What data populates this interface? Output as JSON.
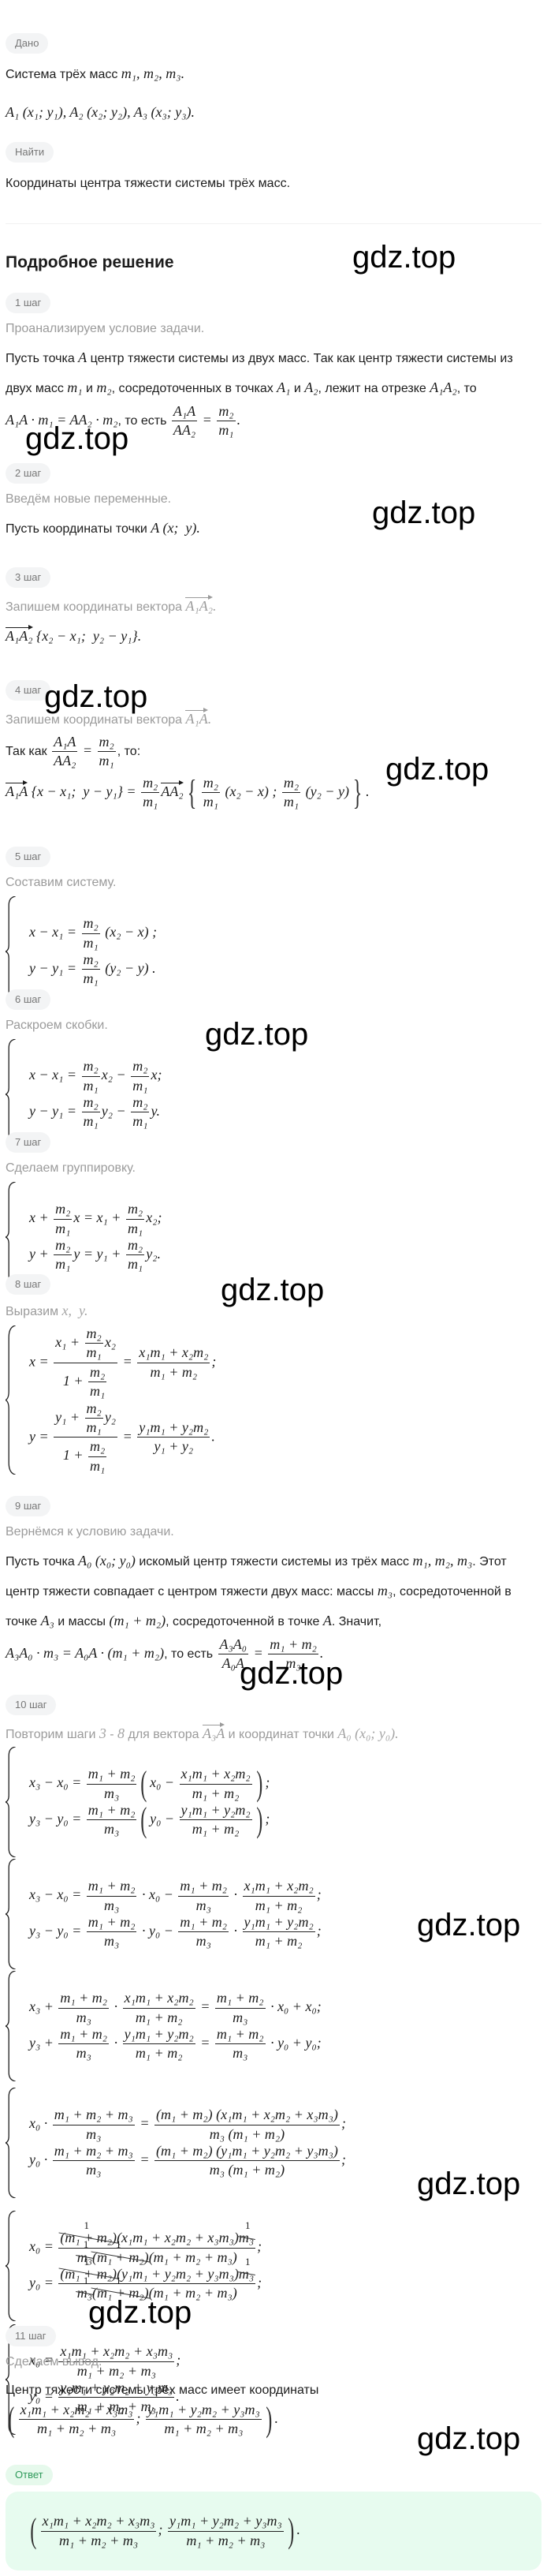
{
  "given": {
    "label": "Дано",
    "line1": [
      {
        "txt": "Система трёх масс "
      },
      "m₁, m₂, m₃."
    ],
    "line2": [
      "A₁ (x₁; y₁), A₂ (x₂; y₂), A₃ (x₃; y₃)."
    ]
  },
  "find": {
    "label": "Найти",
    "text": "Координаты центра тяжести системы трёх масс."
  },
  "solution_title": "Подробное решение",
  "steps": [
    {
      "label": "1 шаг",
      "caption": [
        {
          "txt": "Проанализируем условие задачи."
        }
      ],
      "body": [
        {
          "txt": "Пусть точка "
        },
        "A",
        {
          "txt": " центр тяжести системы из двух масс. Так как центр тяжести системы из двух масс "
        },
        "m₁",
        {
          "txt": " и "
        },
        "m₂",
        {
          "txt": ", сосредоточенных в точках "
        },
        "A₁",
        {
          "txt": " и "
        },
        "A₂",
        {
          "txt": ", лежит на отрезке "
        },
        "A₁A₂",
        {
          "txt": ", то "
        },
        "A₁A · m₁ = AA₂ · m₂",
        {
          "txt": ", то есть "
        },
        {
          "f": [
            "A₁A",
            "AA₂"
          ]
        },
        " = ",
        {
          "f": [
            "m₂",
            "m₁"
          ]
        },
        "."
      ]
    },
    {
      "label": "2 шаг",
      "caption": [
        {
          "txt": "Введём новые переменные."
        }
      ],
      "body": [
        {
          "txt": "Пусть координаты точки "
        },
        "A (x;  y)."
      ]
    },
    {
      "label": "3 шаг",
      "caption": [
        {
          "txt": "Запишем координаты вектора "
        },
        {
          "vec": "A₁A₂"
        },
        "."
      ],
      "body": [
        {
          "vec": "A₁A₂"
        },
        " {x₂ − x₁;  y₂ − y₁}."
      ]
    },
    {
      "label": "4 шаг",
      "caption": [
        {
          "txt": "Запишем координаты вектора "
        },
        {
          "vec": "A₁A"
        },
        "."
      ],
      "body": [
        {
          "txt": "Так как "
        },
        {
          "f": [
            "A₁A",
            "AA₂"
          ]
        },
        " = ",
        {
          "f": [
            "m₂",
            "m₁"
          ]
        },
        {
          "txt": ", то:"
        }
      ],
      "body2": [
        {
          "vec": "A₁A"
        },
        " {x − x₁;  y − y₁} = ",
        {
          "f": [
            "m₂",
            "m₁"
          ]
        },
        {
          "vec": "AA₂"
        },
        {
          "o": "{",
          "c": "}",
          "p": [
            {
              "f": [
                "m₂",
                "m₁"
              ]
            },
            " (x₂ − x) ; ",
            {
              "f": [
                "m₂",
                "m₁"
              ]
            },
            " (y₂ − y)"
          ]
        },
        "."
      ]
    },
    {
      "label": "5 шаг",
      "caption": [
        {
          "txt": "Составим систему."
        }
      ],
      "body": [
        {
          "sys": [
            [
              "x − x₁ = ",
              {
                "f": [
                  "m₂",
                  "m₁"
                ]
              },
              " (x₂ − x) ;"
            ],
            [
              "y − y₁ = ",
              {
                "f": [
                  "m₂",
                  "m₁"
                ]
              },
              " (y₂ − y) ."
            ]
          ]
        }
      ]
    },
    {
      "label": "6 шаг",
      "caption": [
        {
          "txt": "Раскроем скобки."
        }
      ],
      "body": [
        {
          "sys": [
            [
              "x − x₁ = ",
              {
                "f": [
                  "m₂",
                  "m₁"
                ]
              },
              "x₂ − ",
              {
                "f": [
                  "m₂",
                  "m₁"
                ]
              },
              "x;"
            ],
            [
              "y − y₁ = ",
              {
                "f": [
                  "m₂",
                  "m₁"
                ]
              },
              "y₂ − ",
              {
                "f": [
                  "m₂",
                  "m₁"
                ]
              },
              "y."
            ]
          ]
        }
      ]
    },
    {
      "label": "7 шаг",
      "caption": [
        {
          "txt": "Сделаем группировку."
        }
      ],
      "body": [
        {
          "sys": [
            [
              "x + ",
              {
                "f": [
                  "m₂",
                  "m₁"
                ]
              },
              "x = x₁ + ",
              {
                "f": [
                  "m₂",
                  "m₁"
                ]
              },
              "x₂;"
            ],
            [
              "y + ",
              {
                "f": [
                  "m₂",
                  "m₁"
                ]
              },
              "y = y₁ + ",
              {
                "f": [
                  "m₂",
                  "m₁"
                ]
              },
              "y₂."
            ]
          ]
        }
      ]
    },
    {
      "label": "8 шаг",
      "caption": [
        {
          "txt": "Выразим "
        },
        "x,  y."
      ],
      "body": [
        {
          "sys": [
            [
              "x = ",
              {
                "f": [
                  [
                    "x₁ + ",
                    {
                      "f": [
                        "m₂",
                        "m₁"
                      ]
                    },
                    "x₂"
                  ],
                  [
                    "1 + ",
                    {
                      "f": [
                        "m₂",
                        "m₁"
                      ]
                    }
                  ]
                ]
              },
              " = ",
              {
                "f": [
                  "x₁m₁ + x₂m₂",
                  "m₁ + m₂"
                ]
              },
              ";"
            ],
            [
              "y = ",
              {
                "f": [
                  [
                    "y₁ + ",
                    {
                      "f": [
                        "m₂",
                        "m₁"
                      ]
                    },
                    "y₂"
                  ],
                  [
                    "1 + ",
                    {
                      "f": [
                        "m₂",
                        "m₁"
                      ]
                    }
                  ]
                ]
              },
              " = ",
              {
                "f": [
                  "y₁m₁ + y₂m₂",
                  "y₁ + y₂"
                ]
              },
              "."
            ]
          ]
        }
      ]
    },
    {
      "label": "9 шаг",
      "caption": [
        {
          "txt": "Вернёмся к условию задачи."
        }
      ],
      "body": [
        {
          "txt": "Пусть точка "
        },
        "A₀ (x₀; y₀)",
        {
          "txt": " искомый центр тяжести системы из трёх масс "
        },
        "m₁, m₂, m₃",
        {
          "txt": ". Этот центр тяжести совпадает с центром тяжести двух масс: массы "
        },
        "m₃",
        {
          "txt": ", сосредоточенной в точке "
        },
        "A₃",
        {
          "txt": " и массы "
        },
        "(m₁ + m₂)",
        {
          "txt": ", сосредоточенной в точке "
        },
        "A",
        {
          "txt": ". Значит, "
        },
        "A₃A₀ · m₃ = A₀A · (m₁ + m₂)",
        {
          "txt": ", то есть "
        },
        {
          "f": [
            "A₃A₀",
            "A₀A"
          ]
        },
        " = ",
        {
          "f": [
            "m₁ + m₂",
            "m₃"
          ]
        },
        "."
      ]
    },
    {
      "label": "10 шаг",
      "caption": [
        {
          "txt": "Повторим шаги "
        },
        "3",
        {
          "txt": " - "
        },
        "8",
        {
          "txt": " для вектора "
        },
        {
          "vec": "A₃A"
        },
        {
          "txt": " и координат точки "
        },
        "A₀ (x₀; y₀)."
      ],
      "systems": [
        {
          "sys": [
            [
              "x₃ − x₀ = ",
              {
                "f": [
                  "m₁ + m₂",
                  "m₃"
                ]
              },
              {
                "p": [
                  "x₀ − ",
                  {
                    "f": [
                      "x₁m₁ + x₂m₂",
                      "m₁ + m₂"
                    ]
                  }
                ]
              },
              ";"
            ],
            [
              "y₃ − y₀ = ",
              {
                "f": [
                  "m₁ + m₂",
                  "m₃"
                ]
              },
              {
                "p": [
                  "y₀ − ",
                  {
                    "f": [
                      "y₁m₁ + y₂m₂",
                      "m₁ + m₂"
                    ]
                  }
                ]
              },
              ";"
            ]
          ]
        },
        {
          "sys": [
            [
              "x₃ − x₀ = ",
              {
                "f": [
                  "m₁ + m₂",
                  "m₃"
                ]
              },
              " · x₀ − ",
              {
                "f": [
                  "m₁ + m₂",
                  "m₃"
                ]
              },
              " · ",
              {
                "f": [
                  "x₁m₁ + x₂m₂",
                  "m₁ + m₂"
                ]
              },
              ";"
            ],
            [
              "y₃ − y₀ = ",
              {
                "f": [
                  "m₁ + m₂",
                  "m₃"
                ]
              },
              " · y₀ − ",
              {
                "f": [
                  "m₁ + m₂",
                  "m₃"
                ]
              },
              " · ",
              {
                "f": [
                  "y₁m₁ + y₂m₂",
                  "m₁ + m₂"
                ]
              },
              ";"
            ]
          ]
        },
        {
          "sys": [
            [
              "x₃ + ",
              {
                "f": [
                  "m₁ + m₂",
                  "m₃"
                ]
              },
              " · ",
              {
                "f": [
                  "x₁m₁ + x₂m₂",
                  "m₁ + m₂"
                ]
              },
              " = ",
              {
                "f": [
                  "m₁ + m₂",
                  "m₃"
                ]
              },
              " · x₀ + x₀;"
            ],
            [
              "y₃ + ",
              {
                "f": [
                  "m₁ + m₂",
                  "m₃"
                ]
              },
              " · ",
              {
                "f": [
                  "y₁m₁ + y₂m₂",
                  "m₁ + m₂"
                ]
              },
              " = ",
              {
                "f": [
                  "m₁ + m₂",
                  "m₃"
                ]
              },
              " · y₀ + y₀;"
            ]
          ]
        },
        {
          "sys": [
            [
              "x₀ · ",
              {
                "f": [
                  "m₁ + m₂ + m₃",
                  "m₃"
                ]
              },
              " = ",
              {
                "f": [
                  "(m₁ + m₂) (x₁m₁ + x₂m₂ + x₃m₃)",
                  "m₃ (m₁ + m₂)"
                ]
              },
              ";"
            ],
            [
              "y₀ · ",
              {
                "f": [
                  "m₁ + m₂ + m₃",
                  "m₃"
                ]
              },
              " = ",
              {
                "f": [
                  "(m₁ + m₂) (y₁m₁ + y₂m₂ + y₃m₃)",
                  "m₃ (m₁ + m₂)"
                ]
              },
              ";"
            ]
          ]
        },
        {
          "sys": [
            [
              "x₀ = ",
              {
                "f": [
                  [
                    {
                      "c": "(m₁ + m₂)",
                      "r": "1"
                    },
                    "(x₁m₁ + x₂m₂ + x₃m₃)",
                    {
                      "c": "m₃",
                      "r": "1"
                    }
                  ],
                  [
                    {
                      "c": "m₃",
                      "r": "1"
                    },
                    {
                      "c": "(m₁ + m₂)",
                      "r": "1"
                    },
                    "(m₁ + m₂ + m₃)"
                  ]
                ]
              },
              ";"
            ],
            [
              "y₀ = ",
              {
                "f": [
                  [
                    {
                      "c": "(m₁ + m₂)",
                      "r": "1"
                    },
                    "(y₁m₁ + y₂m₂ + y₃m₃)",
                    {
                      "c": "m₃",
                      "r": "1"
                    }
                  ],
                  [
                    {
                      "c": "m₃",
                      "r": "1"
                    },
                    {
                      "c": "(m₁ + m₂)",
                      "r": "1"
                    },
                    "(m₁ + m₂ + m₃)"
                  ]
                ]
              },
              ";"
            ]
          ]
        },
        {
          "sys": [
            [
              "x₀ = ",
              {
                "f": [
                  "x₁m₁ + x₂m₂ + x₃m₃",
                  "m₁ + m₂ + m₃"
                ]
              },
              ";"
            ],
            [
              "y₀ = ",
              {
                "f": [
                  "y₁m₁ + y₂m₂ + y₃m₃",
                  "m₁ + m₂ + m₃"
                ]
              },
              "."
            ]
          ]
        }
      ]
    },
    {
      "label": "11 шаг",
      "caption": [
        {
          "txt": "Сделаем вывод."
        }
      ],
      "body": [
        {
          "txt": "Центр тяжести системы трёх масс имеет координаты"
        }
      ],
      "body2": [
        {
          "p": [
            {
              "f": [
                "x₁m₁ + x₂m₂ + x₃m₃",
                "m₁ + m₂ + m₃"
              ]
            },
            "; ",
            {
              "f": [
                "y₁m₁ + y₂m₂ + y₃m₃",
                "m₁ + m₂ + m₃"
              ]
            }
          ]
        },
        "."
      ]
    }
  ],
  "answer": {
    "label": "Ответ",
    "formula": [
      {
        "p": [
          {
            "f": [
              "x₁m₁ + x₂m₂ + x₃m₃",
              "m₁ + m₂ + m₃"
            ]
          },
          "; ",
          {
            "f": [
              "y₁m₁ + y₂m₂ + y₃m₃",
              "m₁ + m₂ + m₃"
            ]
          }
        ]
      },
      "."
    ]
  },
  "watermark": "gdz.top",
  "colors": {
    "pill_bg": "#f3f4f5",
    "answer_bg": "#e7fbef",
    "answer_label": "#2f9a5a",
    "caption": "#9b9b9b"
  }
}
